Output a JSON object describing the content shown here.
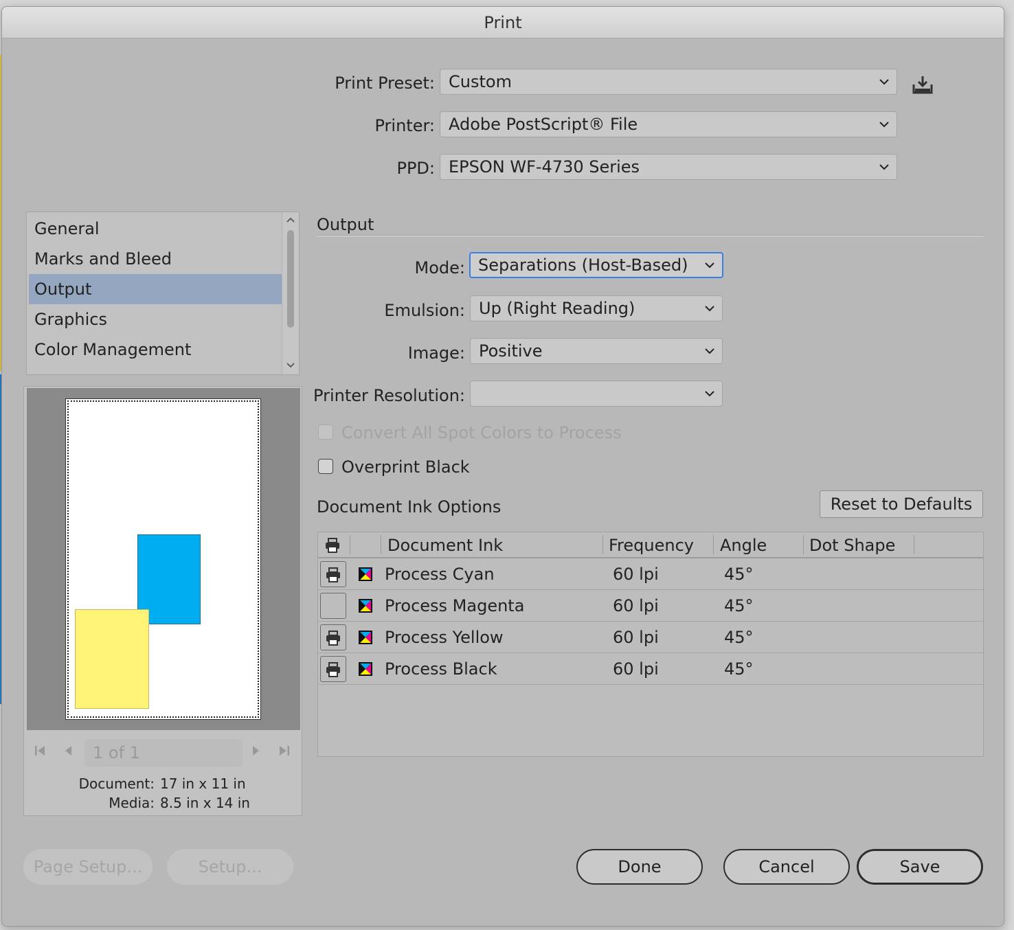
{
  "window": {
    "title": "Print"
  },
  "header": {
    "print_preset": {
      "label": "Print Preset:",
      "value": "Custom"
    },
    "printer": {
      "label": "Printer:",
      "value": "Adobe PostScript® File"
    },
    "ppd": {
      "label": "PPD:",
      "value": "EPSON WF-4730 Series"
    }
  },
  "sidebar": {
    "items": [
      {
        "label": "General",
        "selected": false
      },
      {
        "label": "Marks and Bleed",
        "selected": false
      },
      {
        "label": "Output",
        "selected": true
      },
      {
        "label": "Graphics",
        "selected": false
      },
      {
        "label": "Color Management",
        "selected": false
      }
    ]
  },
  "preview": {
    "page_indicator": "1 of 1",
    "document_label": "Document:",
    "document_value": "17 in x 11 in",
    "media_label": "Media:",
    "media_value": "8.5 in x 14 in",
    "colors": {
      "cyan": "#00adee",
      "yellow": "#fff477"
    }
  },
  "output": {
    "section_title": "Output",
    "mode": {
      "label": "Mode:",
      "value": "Separations (Host-Based)"
    },
    "emulsion": {
      "label": "Emulsion:",
      "value": "Up (Right Reading)"
    },
    "image": {
      "label": "Image:",
      "value": "Positive"
    },
    "printer_resolution": {
      "label": "Printer Resolution:",
      "value": ""
    },
    "convert_spot": {
      "label": "Convert All Spot Colors to Process",
      "checked": false,
      "enabled": false
    },
    "overprint_black": {
      "label": "Overprint Black",
      "checked": false,
      "enabled": true
    }
  },
  "ink_options": {
    "title": "Document Ink Options",
    "reset_label": "Reset to Defaults",
    "columns": [
      "Document Ink",
      "Frequency",
      "Angle",
      "Dot Shape"
    ],
    "rows": [
      {
        "print": true,
        "ink": "Process Cyan",
        "frequency": "60 lpi",
        "angle": "45°",
        "dot_shape": ""
      },
      {
        "print": false,
        "ink": "Process Magenta",
        "frequency": "60 lpi",
        "angle": "45°",
        "dot_shape": ""
      },
      {
        "print": true,
        "ink": "Process Yellow",
        "frequency": "60 lpi",
        "angle": "45°",
        "dot_shape": ""
      },
      {
        "print": true,
        "ink": "Process Black",
        "frequency": "60 lpi",
        "angle": "45°",
        "dot_shape": ""
      }
    ]
  },
  "footer": {
    "page_setup_label": "Page Setup...",
    "setup_label": "Setup...",
    "done_label": "Done",
    "cancel_label": "Cancel",
    "save_label": "Save"
  },
  "icons": {
    "save_preset": "save-preset-icon",
    "printer": "printer-icon",
    "ink_swatch": "cmyk-swatch-icon"
  }
}
